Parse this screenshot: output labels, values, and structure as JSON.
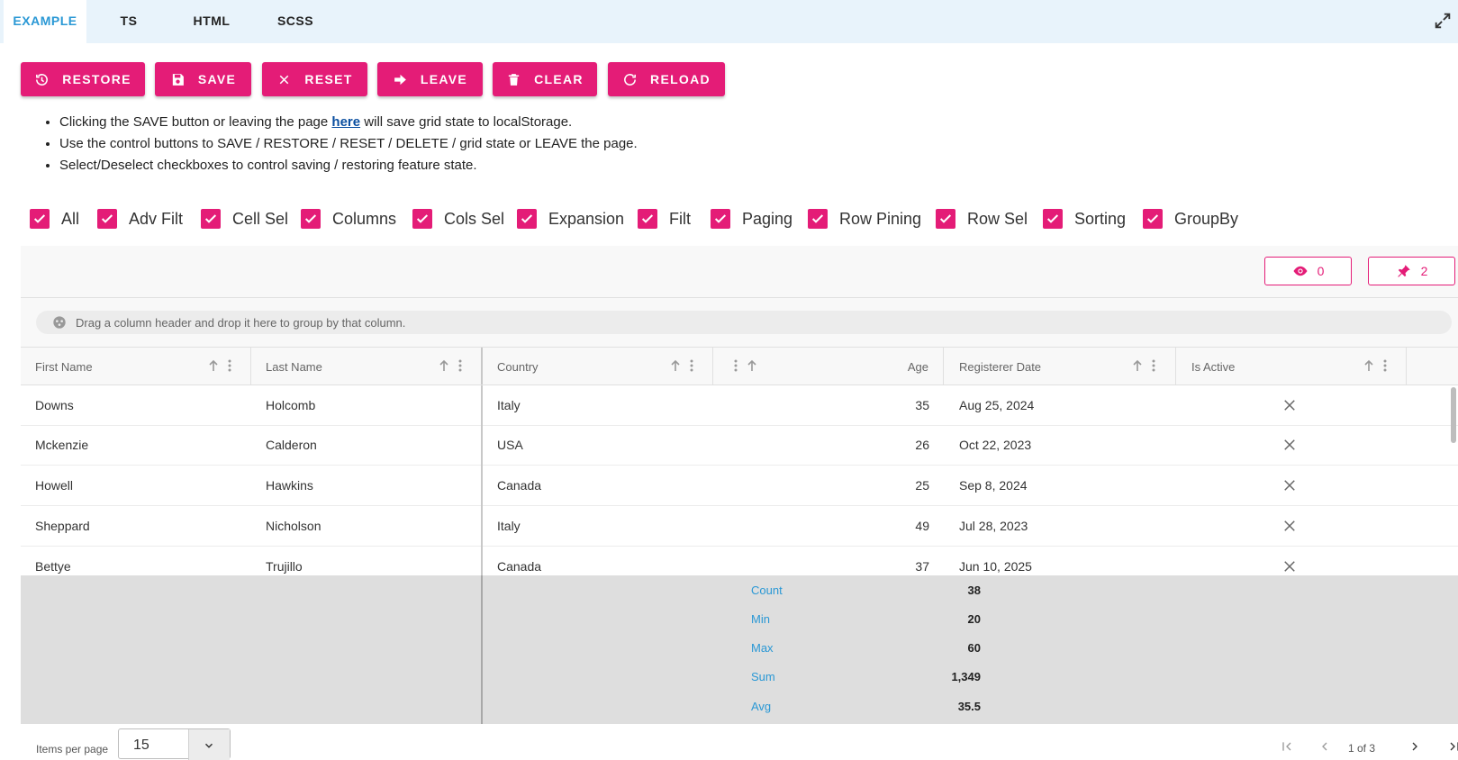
{
  "tabs": [
    {
      "label": "EXAMPLE"
    },
    {
      "label": "TS"
    },
    {
      "label": "HTML"
    },
    {
      "label": "SCSS"
    }
  ],
  "toolbar": {
    "restore": "RESTORE",
    "save": "SAVE",
    "reset": "RESET",
    "leave": "LEAVE",
    "clear": "CLEAR",
    "reload": "RELOAD"
  },
  "notes": {
    "line1_before": "Clicking the SAVE button or leaving the page ",
    "line1_link": "here",
    "line1_after": " will save grid state to localStorage.",
    "line2": "Use the control buttons to SAVE / RESTORE / RESET / DELETE / grid state or LEAVE the page.",
    "line3": "Select/Deselect checkboxes to control saving / restoring feature state."
  },
  "features": [
    {
      "label": "All",
      "checked": true
    },
    {
      "label": "Adv Filt",
      "checked": true
    },
    {
      "label": "Cell Sel",
      "checked": true
    },
    {
      "label": "Columns",
      "checked": true
    },
    {
      "label": "Cols Sel",
      "checked": true
    },
    {
      "label": "Expansion",
      "checked": true
    },
    {
      "label": "Filt",
      "checked": true
    },
    {
      "label": "Paging",
      "checked": true
    },
    {
      "label": "Row Pining",
      "checked": true
    },
    {
      "label": "Row Sel",
      "checked": true
    },
    {
      "label": "Sorting",
      "checked": true
    },
    {
      "label": "GroupBy",
      "checked": true
    }
  ],
  "grid_toolbar": {
    "hidden_count": "0",
    "pinned_count": "2"
  },
  "group_area": {
    "text": "Drag a column header and drop it here to group by that column."
  },
  "columns": [
    {
      "header": "First Name"
    },
    {
      "header": "Last Name"
    },
    {
      "header": "Country"
    },
    {
      "header": "Age"
    },
    {
      "header": "Registerer Date"
    },
    {
      "header": "Is Active"
    }
  ],
  "rows": [
    {
      "first": "Downs",
      "last": "Holcomb",
      "country": "Italy",
      "age": "35",
      "date": "Aug 25, 2024",
      "active": false
    },
    {
      "first": "Mckenzie",
      "last": "Calderon",
      "country": "USA",
      "age": "26",
      "date": "Oct 22, 2023",
      "active": false
    },
    {
      "first": "Howell",
      "last": "Hawkins",
      "country": "Canada",
      "age": "25",
      "date": "Sep 8, 2024",
      "active": false
    },
    {
      "first": "Sheppard",
      "last": "Nicholson",
      "country": "Italy",
      "age": "49",
      "date": "Jul 28, 2023",
      "active": false
    },
    {
      "first": "Bettye",
      "last": "Trujillo",
      "country": "Canada",
      "age": "37",
      "date": "Jun 10, 2025",
      "active": false
    }
  ],
  "summary": [
    {
      "label": "Count",
      "value": "38"
    },
    {
      "label": "Min",
      "value": "20"
    },
    {
      "label": "Max",
      "value": "60"
    },
    {
      "label": "Sum",
      "value": "1,349"
    },
    {
      "label": "Avg",
      "value": "35.5"
    }
  ],
  "paginator": {
    "items_label": "Items per page",
    "page_size": "15",
    "page_text": "1 of 3"
  },
  "colors": {
    "accent": "#e41c77",
    "tab_active": "#2a98d5",
    "tabbar_bg": "#e8f3fb"
  }
}
